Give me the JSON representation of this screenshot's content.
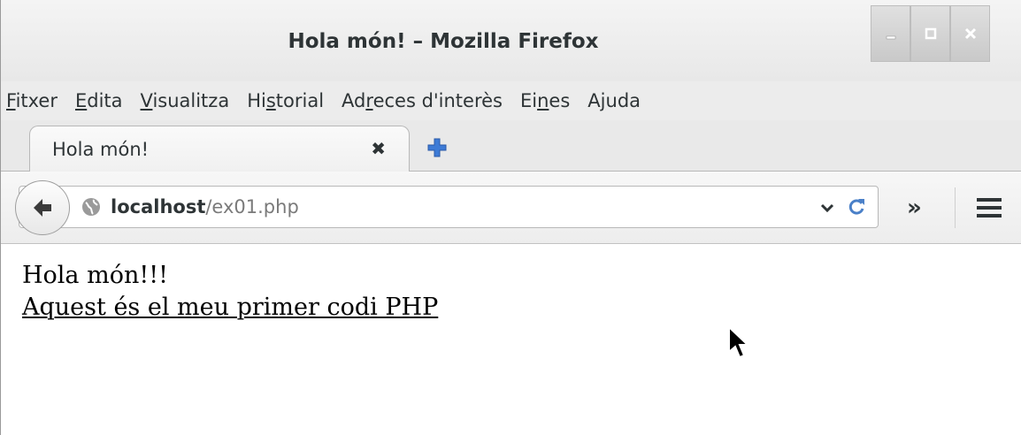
{
  "window": {
    "title": "Hola món! – Mozilla Firefox",
    "controls": [
      "minimize",
      "maximize",
      "close"
    ]
  },
  "menubar": {
    "items": [
      {
        "pre": "",
        "acc": "F",
        "post": "itxer"
      },
      {
        "pre": "",
        "acc": "E",
        "post": "dita"
      },
      {
        "pre": "",
        "acc": "V",
        "post": "isualitza"
      },
      {
        "pre": "Hi",
        "acc": "s",
        "post": "torial"
      },
      {
        "pre": "Ad",
        "acc": "r",
        "post": "eces d'interès"
      },
      {
        "pre": "Ei",
        "acc": "n",
        "post": "es"
      },
      {
        "pre": "A",
        "acc": "j",
        "post": "uda"
      }
    ]
  },
  "tabs": [
    {
      "label": "Hola món!",
      "close": "✖"
    }
  ],
  "navbar": {
    "url_host": "localhost",
    "url_path": "/ex01.php",
    "overflow": "»"
  },
  "page": {
    "heading": "Hola món!!!",
    "link_text": "Aquest és el meu primer codi PHP"
  },
  "colors": {
    "newtab_blue": "#3d7bd6",
    "reload_blue": "#4a80c8"
  }
}
